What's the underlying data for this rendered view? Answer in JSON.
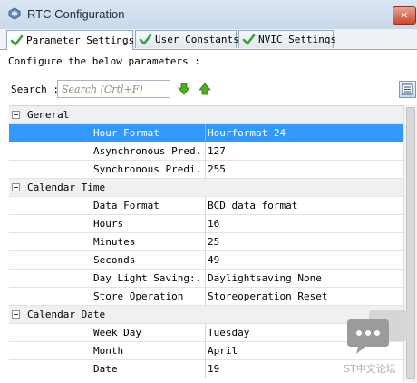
{
  "window": {
    "title": "RTC Configuration",
    "close_label": "×"
  },
  "tabs": [
    {
      "label": "Parameter Settings",
      "active": true
    },
    {
      "label": "User Constants",
      "active": false
    },
    {
      "label": "NVIC Settings",
      "active": false
    }
  ],
  "instructions": "Configure the below parameters :",
  "search": {
    "label": "Search :",
    "placeholder": "Search (Crtl+F)"
  },
  "groups": [
    {
      "name": "General",
      "params": [
        {
          "name": "Hour Format",
          "value": "Hourformat 24",
          "selected": true
        },
        {
          "name": "Asynchronous Pred...",
          "value": "127"
        },
        {
          "name": "Synchronous Predi...",
          "value": "255"
        }
      ]
    },
    {
      "name": "Calendar Time",
      "params": [
        {
          "name": "Data Format",
          "value": "BCD data format"
        },
        {
          "name": "Hours",
          "value": "16"
        },
        {
          "name": "Minutes",
          "value": "25"
        },
        {
          "name": "Seconds",
          "value": "49"
        },
        {
          "name": "Day Light Saving:...",
          "value": "Daylightsaving None"
        },
        {
          "name": "Store Operation",
          "value": "Storeoperation Reset"
        }
      ]
    },
    {
      "name": "Calendar Date",
      "params": [
        {
          "name": "Week Day",
          "value": "Tuesday"
        },
        {
          "name": "Month",
          "value": "April"
        },
        {
          "name": "Date",
          "value": "19"
        }
      ]
    }
  ],
  "watermark": {
    "text": "ST中文论坛"
  },
  "colors": {
    "selection": "#3399ff",
    "check": "#3aa33a",
    "arrow": "#4caf1f"
  }
}
